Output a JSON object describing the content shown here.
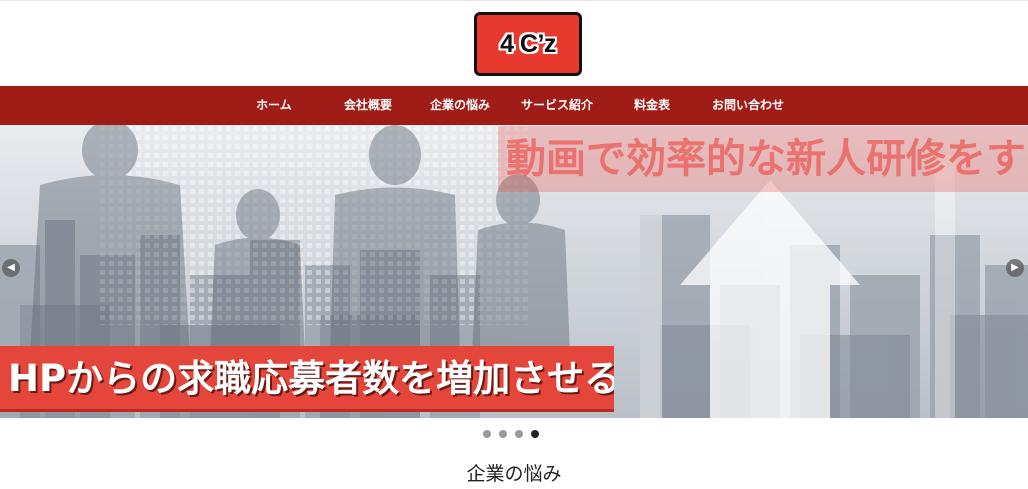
{
  "header": {
    "logo_text": "4 C’z"
  },
  "nav": {
    "items": [
      {
        "label": "ホーム"
      },
      {
        "label": "会社概要"
      },
      {
        "label": "企業の悩み"
      },
      {
        "label": "サービス紹介"
      },
      {
        "label": "料金表"
      },
      {
        "label": "お問い合わせ"
      }
    ]
  },
  "hero": {
    "caption_top": "動画で効率的な新人研修をする！",
    "caption_bottom": "HPからの求職応募者数を増加させる",
    "prev_icon": "chevron-left-icon",
    "next_icon": "chevron-right-icon",
    "slide_count": 4,
    "active_slide": 4
  },
  "section": {
    "title": "企業の悩み"
  }
}
